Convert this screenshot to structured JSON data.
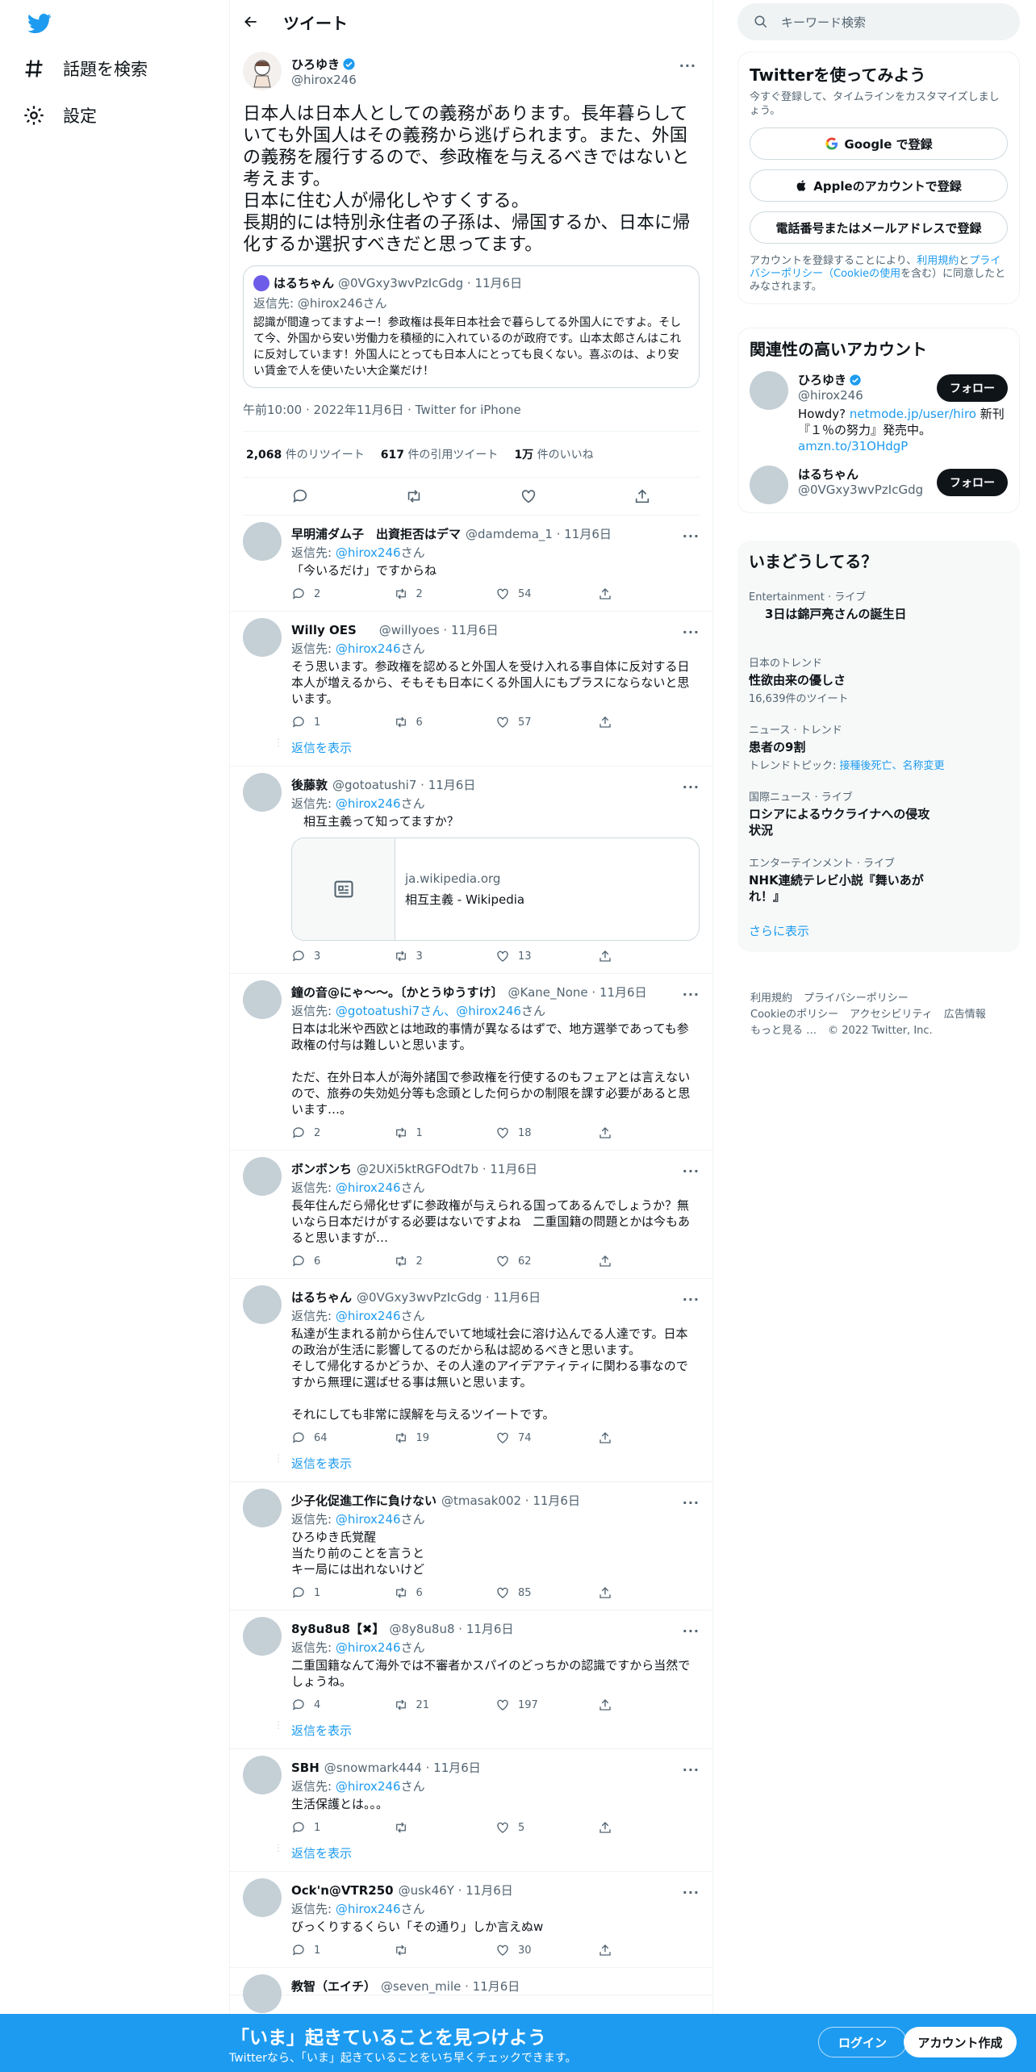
{
  "nav": {
    "explore_label": "話題を検索",
    "settings_label": "設定"
  },
  "header": {
    "title": "ツイート"
  },
  "main_tweet": {
    "author_name": "ひろゆき",
    "handle": "@hirox246",
    "text": "日本人は日本人としての義務があります。長年暮らしていても外国人はその義務から逃げられます。また、外国の義務を履行するので、参政権を与えるべきではないと考えます。\n日本に住む人が帰化しやすくする。\n長期的には特別永住者の子孫は、帰国するか、日本に帰化するか選択すべきだと思ってます。",
    "quote": {
      "name": "はるちゃん",
      "handle_date": "@0VGxy3wvPzIcGdg · 11月6日",
      "reply_to": "返信先: @hirox246さん",
      "text": "認識が間違ってますよー！参政権は長年日本社会で暮らしてる外国人にですよ。そして今、外国から安い労働力を積極的に入れているのが政府です。山本太郎さんはこれに反対しています！外国人にとっても日本人にとっても良くない。喜ぶのは、より安い賃金で人を使いたい大企業だけ！"
    },
    "meta": "午前10:00 · 2022年11月6日 · Twitter for iPhone",
    "stats": {
      "retweets_num": "2,068",
      "retweets_label": "件のリツイート",
      "quotes_num": "617",
      "quotes_label": "件の引用ツイート",
      "likes_num": "1万",
      "likes_label": "件のいいね"
    }
  },
  "replies": [
    {
      "name": "早明浦ダム子　出資拒否はデマ",
      "handle_date": "@damdema_1 · 11月6日",
      "reply_prefix": "返信先: ",
      "reply_to": "@hirox246",
      "reply_suffix": "さん",
      "text": "「今いるだけ」ですからね",
      "replies": "2",
      "retweets": "2",
      "likes": "54"
    },
    {
      "name": "Willy OES",
      "handle_date": "@willyoes · 11月6日",
      "reply_prefix": "返信先: ",
      "reply_to": "@hirox246",
      "reply_suffix": "さん",
      "text": "そう思います。参政権を認めると外国人を受け入れる事自体に反対する日本人が増えるから、そもそも日本にくる外国人にもプラスにならないと思います。",
      "replies": "1",
      "retweets": "6",
      "likes": "57",
      "show_more": "返信を表示"
    },
    {
      "name": "後藤敦",
      "handle_date": "@gotoatushi7 · 11月6日",
      "reply_prefix": "返信先: ",
      "reply_to": "@hirox246",
      "reply_suffix": "さん",
      "text": "　相互主義って知ってますか？",
      "card_domain": "ja.wikipedia.org",
      "card_title": "相互主義 - Wikipedia",
      "replies": "3",
      "retweets": "3",
      "likes": "13"
    },
    {
      "name": "鐘の音@にゃ～～。〔かとうゆうすけ〕",
      "handle_date": "@Kane_None · 11月6日",
      "reply_prefix": "返信先: ",
      "reply_to": "@gotoatushi7さん、@hirox246",
      "reply_suffix": "さん",
      "text": "日本は北米や西欧とは地政的事情が異なるはずで、地方選挙であっても参政権の付与は難しいと思います。\n\nただ、在外日本人が海外諸国で参政権を行使するのもフェアとは言えないので、旅券の失効処分等も念頭とした何らかの制限を課す必要があると思います…。",
      "replies": "2",
      "retweets": "1",
      "likes": "18"
    },
    {
      "name": "ボンボンち",
      "handle_date": "@2UXi5ktRGFOdt7b · 11月6日",
      "reply_prefix": "返信先: ",
      "reply_to": "@hirox246",
      "reply_suffix": "さん",
      "text": "長年住んだら帰化せずに参政権が与えられる国ってあるんでしょうか？無いなら日本だけがする必要はないですよね　二重国籍の問題とかは今もあると思いますが…",
      "replies": "6",
      "retweets": "2",
      "likes": "62"
    },
    {
      "name": "はるちゃん",
      "handle_date": "@0VGxy3wvPzIcGdg · 11月6日",
      "reply_prefix": "返信先: ",
      "reply_to": "@hirox246",
      "reply_suffix": "さん",
      "text": "私達が生まれる前から住んでいて地域社会に溶け込んでる人達です。日本の政治が生活に影響してるのだから私は認めるべきと思います。\nそして帰化するかどうか、その人達のアイデアティティに関わる事なのですから無理に選ばせる事は無いと思います。\n\nそれにしても非常に誤解を与えるツイートです。",
      "replies": "64",
      "retweets": "19",
      "likes": "74",
      "show_more": "返信を表示"
    },
    {
      "name": "少子化促進工作に負けない",
      "handle_date": "@tmasak002 · 11月6日",
      "reply_prefix": "返信先: ",
      "reply_to": "@hirox246",
      "reply_suffix": "さん",
      "text": "ひろゆき氏覚醒\n当たり前のことを言うと\nキー局には出れないけど",
      "replies": "1",
      "retweets": "6",
      "likes": "85"
    },
    {
      "name": "8y8u8u8【✖】",
      "handle_date": "@8y8u8u8 · 11月6日",
      "reply_prefix": "返信先: ",
      "reply_to": "@hirox246",
      "reply_suffix": "さん",
      "text": "二重国籍なんて海外では不審者かスパイのどっちかの認識ですから当然でしょうね。",
      "replies": "4",
      "retweets": "21",
      "likes": "197",
      "show_more": "返信を表示"
    },
    {
      "name": "SBH",
      "handle_date": "@snowmark444 · 11月6日",
      "reply_prefix": "返信先: ",
      "reply_to": "@hirox246",
      "reply_suffix": "さん",
      "text": "生活保護とは。。。",
      "replies": "1",
      "retweets": "",
      "likes": "5",
      "show_more": "返信を表示"
    },
    {
      "name": "Ock'n@VTR250",
      "handle_date": "@usk46Y · 11月6日",
      "reply_prefix": "返信先: ",
      "reply_to": "@hirox246",
      "reply_suffix": "さん",
      "text": "びっくりするくらい「その通り」しか言えぬw",
      "replies": "1",
      "retweets": "",
      "likes": "30"
    },
    {
      "name": "教智（エイチ）",
      "handle_date": "@seven_mile · 11月6日"
    }
  ],
  "right": {
    "search_placeholder": "キーワード検索",
    "signup": {
      "title": "Twitterを使ってみよう",
      "subtitle": "今すぐ登録して、タイムラインをカスタマイズしましょう。",
      "google_label": "Google で登録",
      "apple_label": "Appleのアカウントで登録",
      "phone_label": "電話番号またはメールアドレスで登録",
      "terms_a": "アカウントを登録することにより、",
      "terms_link1": "利用規約",
      "terms_b": "と",
      "terms_link2": "プライバシーポリシー（Cookieの使用",
      "terms_c": "を含む）に同意したとみなされます。"
    },
    "related": {
      "title": "関連性の高いアカウント",
      "accounts": [
        {
          "name": "ひろゆき",
          "handle": "@hirox246",
          "bio_a": "Howdy? ",
          "bio_link1": "netmode.jp/user/hiro",
          "bio_b": " 新刊『１％の努力』発売中。",
          "bio_link2": "amzn.to/31OHdgP",
          "follow": "フォロー"
        },
        {
          "name": "はるちゃん",
          "handle": "@0VGxy3wvPzIcGdg",
          "follow": "フォロー"
        }
      ]
    },
    "trends": {
      "title": "いまどうしてる？",
      "items": [
        {
          "context": "Entertainment · ライブ",
          "name": "3日は錦戸亮さんの誕生日",
          "extra": ""
        },
        {
          "context": "日本のトレンド",
          "name": "性欲由来の優しさ",
          "extra": "16,639件のツイート"
        },
        {
          "context": "ニュース · トレンド",
          "name": "患者の9割",
          "extra_prefix": "トレンドトピック: ",
          "extra_link": "接種後死亡、名称変更"
        },
        {
          "context": "国際ニュース · ライブ",
          "name": "ロシアによるウクライナへの侵攻状況",
          "extra": ""
        },
        {
          "context": "エンターテインメント · ライブ",
          "name": "NHK連続テレビ小説『舞いあがれ！』",
          "extra": ""
        }
      ],
      "show_more": "さらに表示"
    },
    "footer": {
      "terms": "利用規約",
      "privacy": "プライバシーポリシー",
      "cookie": "Cookieのポリシー",
      "access": "アクセシビリティ",
      "ads": "広告情報",
      "more": "もっと見る …",
      "copyright": "© 2022 Twitter, Inc."
    }
  },
  "bottom_bar": {
    "title": "「いま」起きていることを見つけよう",
    "subtitle": "Twitterなら、「いま」起きていることをいち早くチェックできます。",
    "login": "ログイン",
    "signup": "アカウント作成"
  },
  "colors": {
    "accent": "#1d9bf0",
    "text": "#0f1419",
    "muted": "#536471",
    "border": "#eff3f4"
  }
}
